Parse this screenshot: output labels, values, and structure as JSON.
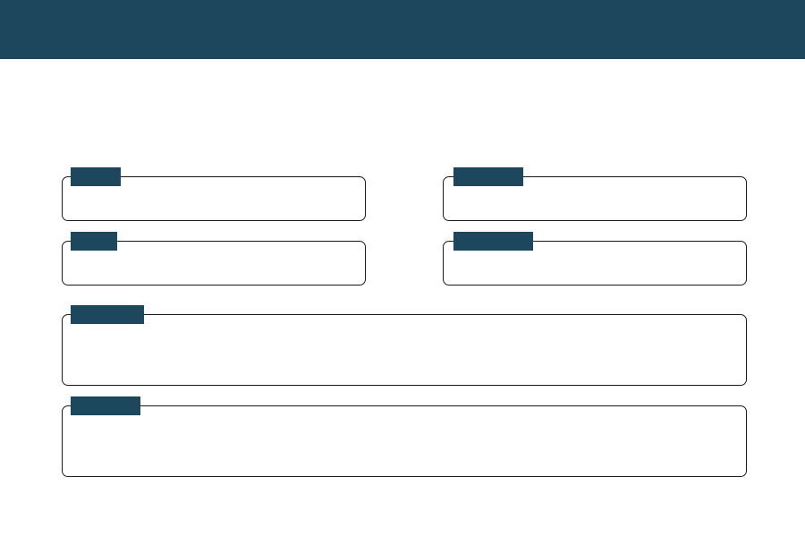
{
  "header": {
    "title": "",
    "background_color": "#1d475c"
  },
  "fields": [
    {
      "label": "",
      "value": ""
    },
    {
      "label": "",
      "value": ""
    },
    {
      "label": "",
      "value": ""
    },
    {
      "label": "",
      "value": ""
    },
    {
      "label": "",
      "value": ""
    },
    {
      "label": "",
      "value": ""
    }
  ],
  "colors": {
    "accent": "#1d475c",
    "border": "#1a1a1a",
    "background": "#ffffff"
  }
}
